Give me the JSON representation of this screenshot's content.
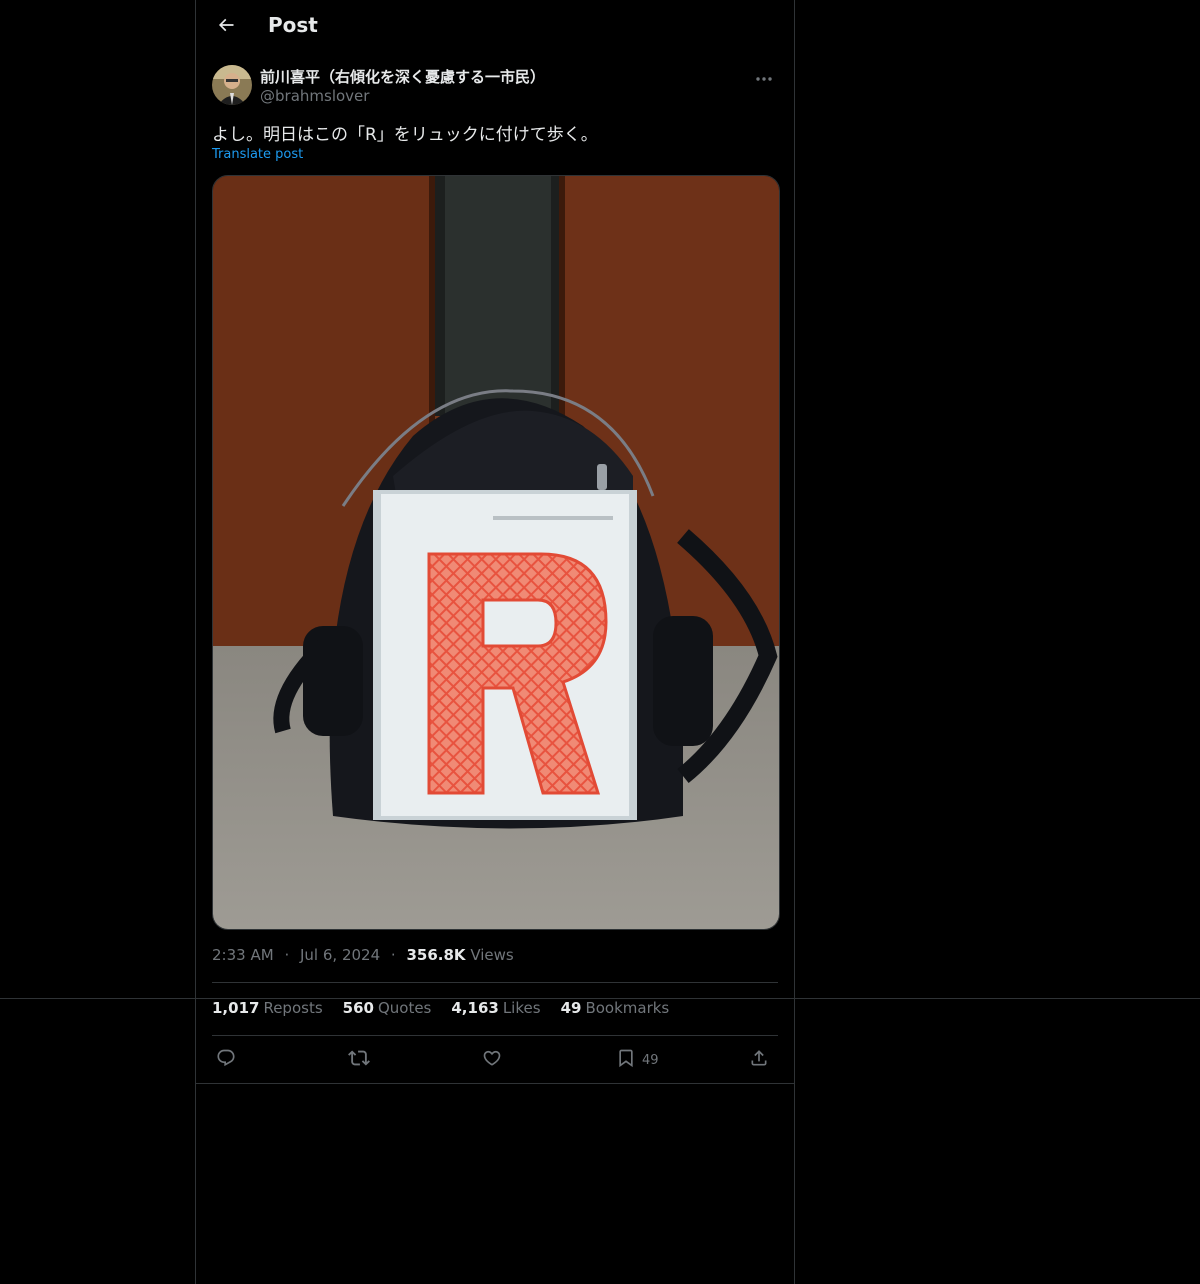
{
  "header": {
    "title": "Post",
    "back_icon": "arrow-left-icon"
  },
  "author": {
    "display_name": "前川喜平（右傾化を深く憂慮する一市民）",
    "handle": "@brahmslover",
    "avatar_icon": "avatar",
    "more_icon": "more-horizontal-icon"
  },
  "post": {
    "text": "よし。明日はこの「R」をリュックに付けて歩く。",
    "translate_label": "Translate post",
    "image_letter": "R"
  },
  "meta": {
    "time": "2:33 AM",
    "date": "Jul 6, 2024",
    "views_count": "356.8K",
    "views_label": "Views",
    "separator": "·"
  },
  "stats": {
    "reposts_count": "1,017",
    "reposts_label": "Reposts",
    "quotes_count": "560",
    "quotes_label": "Quotes",
    "likes_count": "4,163",
    "likes_label": "Likes",
    "bookmarks_count": "49",
    "bookmarks_label": "Bookmarks"
  },
  "actions": {
    "reply_icon": "reply-icon",
    "repost_icon": "repost-icon",
    "like_icon": "heart-icon",
    "bookmark_icon": "bookmark-icon",
    "bookmark_count": "49",
    "share_icon": "share-icon"
  },
  "colors": {
    "background": "#000000",
    "text": "#e7e9ea",
    "muted": "#71767b",
    "link": "#1d9bf0",
    "border": "#2f3336"
  }
}
